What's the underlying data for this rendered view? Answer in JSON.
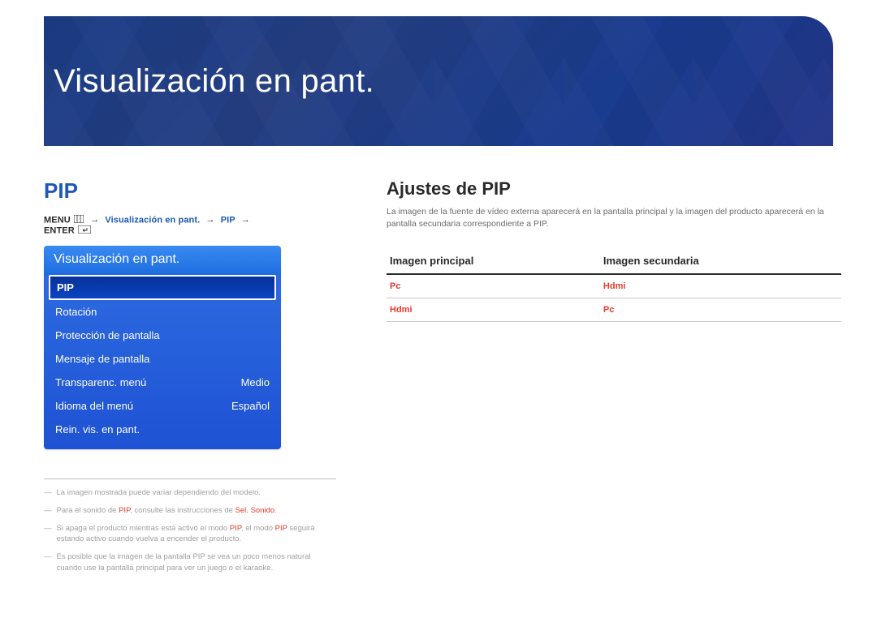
{
  "banner": {
    "title": "Visualización en pant."
  },
  "left": {
    "section_title": "PIP",
    "breadcrumb": {
      "menu_label": "MENU",
      "menu_icon": "menu-grid-icon",
      "arrow": "→",
      "path1": "Visualización en pant.",
      "path2": "PIP",
      "enter_label": "ENTER",
      "enter_icon": "enter-icon"
    },
    "osd": {
      "header": "Visualización en pant.",
      "items": [
        {
          "label": "PIP",
          "value": "",
          "selected": true
        },
        {
          "label": "Rotación",
          "value": ""
        },
        {
          "label": "Protección de pantalla",
          "value": ""
        },
        {
          "label": "Mensaje de pantalla",
          "value": ""
        },
        {
          "label": "Transparenc. menú",
          "value": "Medio"
        },
        {
          "label": "Idioma del menú",
          "value": "Español"
        },
        {
          "label": "Rein. vis. en pant.",
          "value": ""
        }
      ]
    },
    "footnotes": [
      {
        "pre": "La imagen mostrada puede variar dependiendo del modelo.",
        "hl": "",
        "post": ""
      },
      {
        "pre": "Para el sonido de ",
        "hl": "PIP",
        "mid": ", consulte las instrucciones de ",
        "hl2": "Sel. Sonido",
        "post": "."
      },
      {
        "pre": "Si apaga el producto mientras está activo el modo ",
        "hl": "PIP",
        "mid": ", el modo ",
        "hl2": "PIP",
        "post": " seguirá estando activo cuando vuelva a encender el producto."
      },
      {
        "pre": "Es posible que la imagen de la pantalla PIP se vea un poco menos natural cuando use la pantalla principal para ver un juego o el karaoke.",
        "hl": "",
        "post": ""
      }
    ]
  },
  "right": {
    "title": "Ajustes de PIP",
    "desc": "La imagen de la fuente de vídeo externa aparecerá en la pantalla principal y la imagen del producto aparecerá en la pantalla secundaria correspondiente a PIP.",
    "table": {
      "headers": [
        "Imagen principal",
        "Imagen secundaria"
      ],
      "rows": [
        [
          "Pc",
          "Hdmi"
        ],
        [
          "Hdmi",
          "Pc"
        ]
      ]
    }
  }
}
